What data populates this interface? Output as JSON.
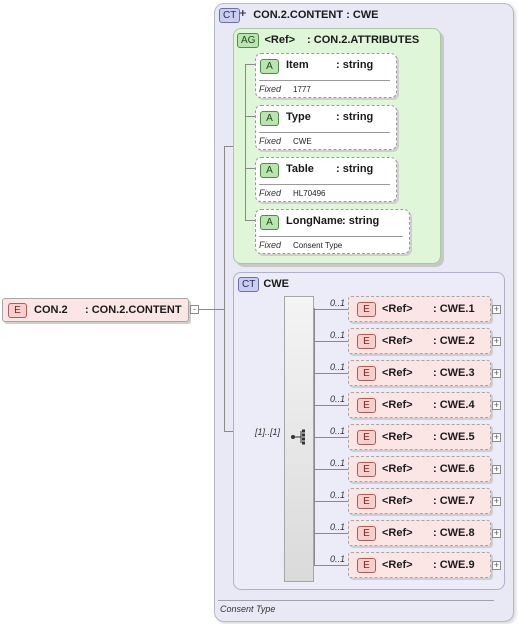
{
  "root_element": {
    "badge": "E",
    "name": "CON.2",
    "type": ": CON.2.CONTENT"
  },
  "complex_type": {
    "badge": "CT",
    "title": "CON.2.CONTENT : CWE",
    "documentation": "Consent Type"
  },
  "attribute_group": {
    "badge": "AG",
    "ref_label": "<Ref>",
    "name": ": CON.2.ATTRIBUTES",
    "attributes": [
      {
        "badge": "A",
        "name": "Item",
        "type": ": string",
        "fixed_label": "Fixed",
        "fixed_value": "1777"
      },
      {
        "badge": "A",
        "name": "Type",
        "type": ": string",
        "fixed_label": "Fixed",
        "fixed_value": "CWE"
      },
      {
        "badge": "A",
        "name": "Table",
        "type": ": string",
        "fixed_label": "Fixed",
        "fixed_value": "HL70496"
      },
      {
        "badge": "A",
        "name": "LongName",
        "type": ": string",
        "fixed_label": "Fixed",
        "fixed_value": "Consent Type"
      }
    ]
  },
  "cwe_type": {
    "badge": "CT",
    "title": "CWE",
    "sequence_cardinality": "[1]..[1]",
    "elements": [
      {
        "badge": "E",
        "cardinality": "0..1",
        "ref": "<Ref>",
        "name": ": CWE.1"
      },
      {
        "badge": "E",
        "cardinality": "0..1",
        "ref": "<Ref>",
        "name": ": CWE.2"
      },
      {
        "badge": "E",
        "cardinality": "0..1",
        "ref": "<Ref>",
        "name": ": CWE.3"
      },
      {
        "badge": "E",
        "cardinality": "0..1",
        "ref": "<Ref>",
        "name": ": CWE.4"
      },
      {
        "badge": "E",
        "cardinality": "0..1",
        "ref": "<Ref>",
        "name": ": CWE.5"
      },
      {
        "badge": "E",
        "cardinality": "0..1",
        "ref": "<Ref>",
        "name": ": CWE.6"
      },
      {
        "badge": "E",
        "cardinality": "0..1",
        "ref": "<Ref>",
        "name": ": CWE.7"
      },
      {
        "badge": "E",
        "cardinality": "0..1",
        "ref": "<Ref>",
        "name": ": CWE.8"
      },
      {
        "badge": "E",
        "cardinality": "0..1",
        "ref": "<Ref>",
        "name": ": CWE.9"
      }
    ]
  }
}
